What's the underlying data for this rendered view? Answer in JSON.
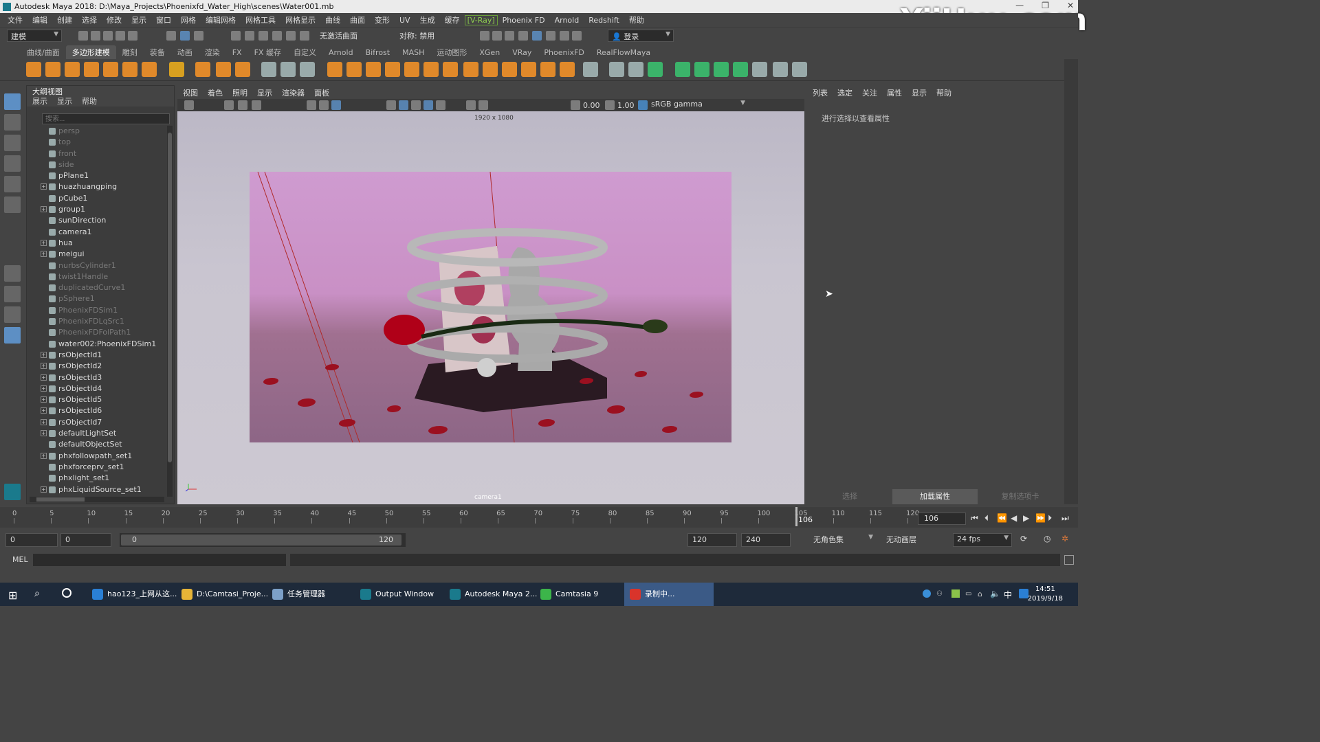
{
  "window": {
    "title": "Autodesk Maya 2018: D:\\Maya_Projects\\Phoenixfd_Water_High\\scenes\\Water001.mb"
  },
  "watermark": "YiiHuu.com",
  "menubar": [
    "文件",
    "编辑",
    "创建",
    "选择",
    "修改",
    "显示",
    "窗口",
    "网格",
    "编辑网格",
    "网格工具",
    "网格显示",
    "曲线",
    "曲面",
    "变形",
    "UV",
    "生成",
    "缓存",
    "[V-Ray]",
    "Phoenix FD",
    "Arnold",
    "Redshift",
    "帮助"
  ],
  "statusline": {
    "mode": "建模",
    "live_surface": "无激活曲面",
    "symmetry": "对称: 禁用",
    "login": "登录"
  },
  "shelf_tabs": [
    "曲线/曲面",
    "多边形建模",
    "雕刻",
    "装备",
    "动画",
    "渲染",
    "FX",
    "FX 缓存",
    "自定义",
    "Arnold",
    "Bifrost",
    "MASH",
    "运动图形",
    "XGen",
    "VRay",
    "PhoenixFD",
    "RealFlowMaya"
  ],
  "shelf_active": "多边形建模",
  "outliner": {
    "title": "大纲视图",
    "menu": [
      "展示",
      "显示",
      "帮助"
    ],
    "search_placeholder": "搜索...",
    "items": [
      {
        "label": "persp",
        "dim": true,
        "expand": false
      },
      {
        "label": "top",
        "dim": true,
        "expand": false
      },
      {
        "label": "front",
        "dim": true,
        "expand": false
      },
      {
        "label": "side",
        "dim": true,
        "expand": false
      },
      {
        "label": "pPlane1",
        "dim": false,
        "expand": false
      },
      {
        "label": "huazhuangping",
        "dim": false,
        "expand": true
      },
      {
        "label": "pCube1",
        "dim": false,
        "expand": false
      },
      {
        "label": "group1",
        "dim": false,
        "expand": true
      },
      {
        "label": "sunDirection",
        "dim": false,
        "expand": false
      },
      {
        "label": "camera1",
        "dim": false,
        "expand": false
      },
      {
        "label": "hua",
        "dim": false,
        "expand": true
      },
      {
        "label": "meigui",
        "dim": false,
        "expand": true
      },
      {
        "label": "nurbsCylinder1",
        "dim": true,
        "expand": false
      },
      {
        "label": "twist1Handle",
        "dim": true,
        "expand": false
      },
      {
        "label": "duplicatedCurve1",
        "dim": true,
        "expand": false
      },
      {
        "label": "pSphere1",
        "dim": true,
        "expand": false
      },
      {
        "label": "PhoenixFDSim1",
        "dim": true,
        "expand": false
      },
      {
        "label": "PhoenixFDLqSrc1",
        "dim": true,
        "expand": false
      },
      {
        "label": "PhoenixFDFolPath1",
        "dim": true,
        "expand": false
      },
      {
        "label": "water002:PhoenixFDSim1",
        "dim": false,
        "expand": false
      },
      {
        "label": "rsObjectId1",
        "dim": false,
        "expand": true
      },
      {
        "label": "rsObjectId2",
        "dim": false,
        "expand": true
      },
      {
        "label": "rsObjectId3",
        "dim": false,
        "expand": true
      },
      {
        "label": "rsObjectId4",
        "dim": false,
        "expand": true
      },
      {
        "label": "rsObjectId5",
        "dim": false,
        "expand": true
      },
      {
        "label": "rsObjectId6",
        "dim": false,
        "expand": true
      },
      {
        "label": "rsObjectId7",
        "dim": false,
        "expand": true
      },
      {
        "label": "defaultLightSet",
        "dim": false,
        "expand": true
      },
      {
        "label": "defaultObjectSet",
        "dim": false,
        "expand": false
      },
      {
        "label": "phxfollowpath_set1",
        "dim": false,
        "expand": true
      },
      {
        "label": "phxforceprv_set1",
        "dim": false,
        "expand": false
      },
      {
        "label": "phxlight_set1",
        "dim": false,
        "expand": false
      },
      {
        "label": "phxLiquidSource_set1",
        "dim": false,
        "expand": true
      }
    ]
  },
  "viewport": {
    "menu": [
      "视图",
      "着色",
      "照明",
      "显示",
      "渲染器",
      "面板"
    ],
    "exposure": "0.00",
    "gamma": "1.00",
    "colorspace": "sRGB gamma",
    "resolution": "1920 x 1080",
    "camera": "camera1"
  },
  "attribute_editor": {
    "menu": [
      "列表",
      "选定",
      "关注",
      "属性",
      "显示",
      "帮助"
    ],
    "hint": "进行选择以查看属性",
    "buttons": [
      "选择",
      "加载属性",
      "复制选项卡"
    ]
  },
  "timeline": {
    "ticks": [
      "0",
      "5",
      "10",
      "15",
      "20",
      "25",
      "30",
      "35",
      "40",
      "45",
      "50",
      "55",
      "60",
      "65",
      "70",
      "75",
      "80",
      "85",
      "90",
      "95",
      "100",
      "105",
      "110",
      "115",
      "120"
    ],
    "current_frame": "106",
    "frame_field": "106"
  },
  "range": {
    "start": "0",
    "anim_start": "0",
    "slider_start": "0",
    "slider_end": "120",
    "end": "120",
    "anim_end": "240",
    "character_set": "无角色集",
    "anim_layer": "无动画层",
    "fps": "24 fps"
  },
  "cmdline": {
    "label": "MEL"
  },
  "taskbar": {
    "items": [
      {
        "label": "hao123_上网从这...",
        "color": "#2a7fd4"
      },
      {
        "label": "D:\\Camtasi_Proje...",
        "color": "#e6b437"
      },
      {
        "label": "任务管理器",
        "color": "#7ca0c8"
      },
      {
        "label": "Output Window",
        "color": "#1a7a8c"
      },
      {
        "label": "Autodesk Maya 2...",
        "color": "#1a7a8c"
      },
      {
        "label": "Camtasia 9",
        "color": "#3cb54a"
      },
      {
        "label": "录制中...",
        "color": "#d9342b"
      }
    ],
    "time": "14:51",
    "date": "2019/9/18",
    "ime": "中"
  }
}
